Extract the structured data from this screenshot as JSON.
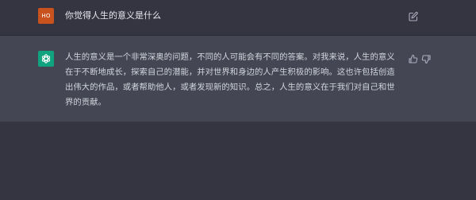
{
  "conversation": {
    "user_message": {
      "avatar_initials": "HO",
      "avatar_color": "#c9531f",
      "text": "你觉得人生的意义是什么",
      "edit_icon": "edit-icon"
    },
    "assistant_message": {
      "avatar_icon": "openai-logo-icon",
      "avatar_color": "#10a37f",
      "text": "人生的意义是一个非常深奥的问题，不同的人可能会有不同的答案。对我来说，人生的意义在于不断地成长，探索自己的潜能，并对世界和身边的人产生积极的影响。这也许包括创造出伟大的作品，或者帮助他人，或者发现新的知识。总之，人生的意义在于我们对自己和世界的贡献。",
      "thumbs_up_icon": "thumbs-up-icon",
      "thumbs_down_icon": "thumbs-down-icon"
    }
  }
}
